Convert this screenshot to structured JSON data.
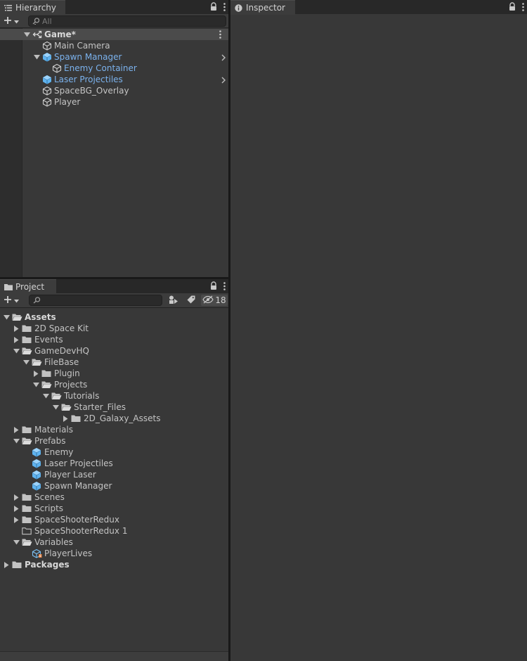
{
  "hierarchy": {
    "tab_label": "Hierarchy",
    "search_placeholder": "All",
    "scene": {
      "label": "Game*"
    },
    "items": [
      {
        "label": "Main Camera",
        "kind": "gameobject",
        "depth": 1
      },
      {
        "label": "Spawn Manager",
        "kind": "prefab",
        "depth": 1,
        "expanded": true,
        "has_children": true
      },
      {
        "label": "Enemy Container",
        "kind": "gameobject-prefab-child",
        "depth": 2
      },
      {
        "label": "Laser Projectiles",
        "kind": "prefab",
        "depth": 1,
        "has_children": false
      },
      {
        "label": "SpaceBG_Overlay",
        "kind": "gameobject",
        "depth": 1
      },
      {
        "label": "Player",
        "kind": "gameobject",
        "depth": 1
      }
    ]
  },
  "inspector": {
    "tab_label": "Inspector"
  },
  "project": {
    "tab_label": "Project",
    "hidden_packages_count": "18",
    "tree": [
      {
        "label": "Assets",
        "depth": 0,
        "expanded": true,
        "bold": true,
        "icon": "folder-open-icon"
      },
      {
        "label": "2D Space Kit",
        "depth": 1,
        "expanded": false,
        "icon": "folder-icon"
      },
      {
        "label": "Events",
        "depth": 1,
        "expanded": false,
        "icon": "folder-icon"
      },
      {
        "label": "GameDevHQ",
        "depth": 1,
        "expanded": true,
        "icon": "folder-open-icon"
      },
      {
        "label": "FileBase",
        "depth": 2,
        "expanded": true,
        "icon": "folder-open-icon"
      },
      {
        "label": "Plugin",
        "depth": 3,
        "expanded": false,
        "icon": "folder-icon"
      },
      {
        "label": "Projects",
        "depth": 3,
        "expanded": true,
        "icon": "folder-open-icon"
      },
      {
        "label": "Tutorials",
        "depth": 4,
        "expanded": true,
        "icon": "folder-open-icon"
      },
      {
        "label": "Starter_Files",
        "depth": 5,
        "expanded": true,
        "icon": "folder-open-icon"
      },
      {
        "label": "2D_Galaxy_Assets",
        "depth": 6,
        "expanded": false,
        "icon": "folder-icon"
      },
      {
        "label": "Materials",
        "depth": 1,
        "expanded": false,
        "icon": "folder-icon"
      },
      {
        "label": "Prefabs",
        "depth": 1,
        "expanded": true,
        "icon": "folder-open-icon"
      },
      {
        "label": "Enemy",
        "depth": 2,
        "icon": "prefab-icon"
      },
      {
        "label": "Laser Projectiles",
        "depth": 2,
        "icon": "prefab-icon"
      },
      {
        "label": "Player Laser",
        "depth": 2,
        "icon": "prefab-icon"
      },
      {
        "label": "Spawn Manager",
        "depth": 2,
        "icon": "prefab-icon"
      },
      {
        "label": "Scenes",
        "depth": 1,
        "expanded": false,
        "icon": "folder-icon"
      },
      {
        "label": "Scripts",
        "depth": 1,
        "expanded": false,
        "icon": "folder-icon"
      },
      {
        "label": "SpaceShooterRedux",
        "depth": 1,
        "expanded": false,
        "icon": "folder-icon"
      },
      {
        "label": "SpaceShooterRedux 1",
        "depth": 1,
        "icon": "folder-empty-icon"
      },
      {
        "label": "Variables",
        "depth": 1,
        "expanded": true,
        "icon": "folder-open-icon"
      },
      {
        "label": "PlayerLives",
        "depth": 2,
        "icon": "scriptable-object-icon"
      },
      {
        "label": "Packages",
        "depth": 0,
        "expanded": false,
        "bold": true,
        "icon": "folder-icon"
      }
    ]
  },
  "colors": {
    "prefab_text": "#7bb2ed",
    "prefab_icon": "#5fb3ef",
    "panel_bg": "#383838",
    "header_bg": "#282828"
  }
}
